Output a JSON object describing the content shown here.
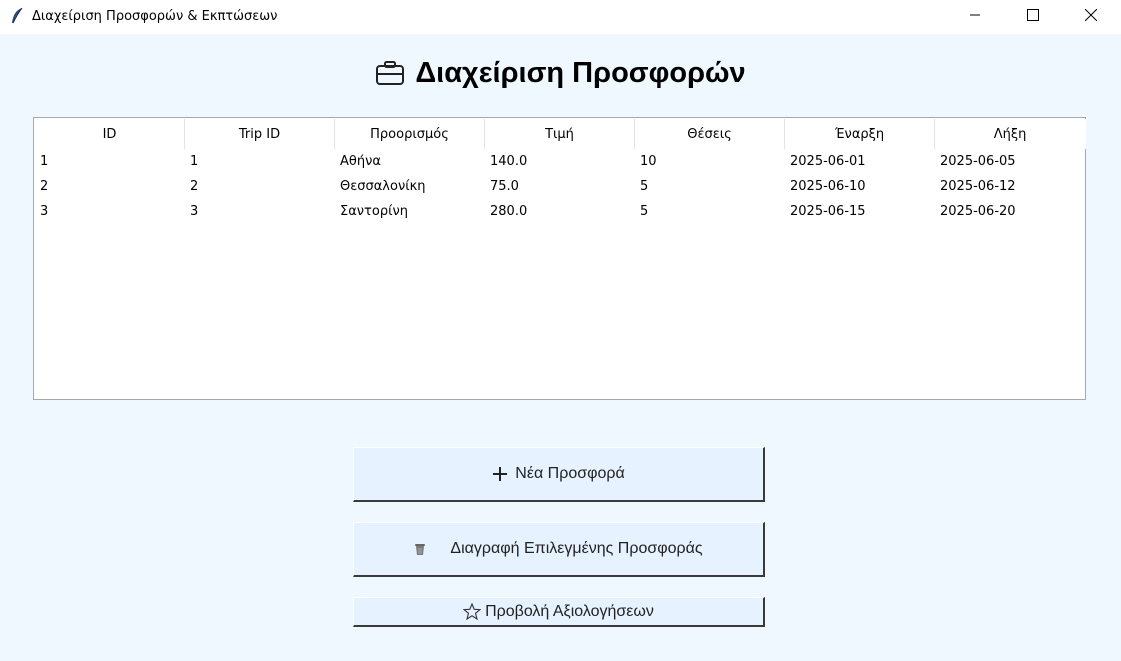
{
  "window": {
    "title": "Διαχείριση Προσφορών & Εκπτώσεων",
    "app_icon": "feather-icon",
    "controls": [
      "minimize-icon",
      "maximize-icon",
      "close-icon"
    ]
  },
  "page": {
    "title": "Διαχείριση Προσφορών",
    "title_icon": "briefcase-icon"
  },
  "table": {
    "columns": [
      "ID",
      "Trip ID",
      "Προορισμός",
      "Τιμή",
      "Θέσεις",
      "Έναρξη",
      "Λήξη"
    ],
    "rows": [
      [
        "1",
        "1",
        "Αθήνα",
        "140.0",
        "10",
        "2025-06-01",
        "2025-06-05"
      ],
      [
        "2",
        "2",
        "Θεσσαλονίκη",
        "75.0",
        "5",
        "2025-06-10",
        "2025-06-12"
      ],
      [
        "3",
        "3",
        "Σαντορίνη",
        "280.0",
        "5",
        "2025-06-15",
        "2025-06-20"
      ]
    ]
  },
  "actions": {
    "new_offer": {
      "label": "Νέα Προσφορά",
      "icon": "plus-icon"
    },
    "delete_selected": {
      "label": "Διαγραφή Επιλεγμένης Προσφοράς",
      "icon": "trash-icon"
    },
    "view_reviews": {
      "label": "Προβολή Αξιολογήσεων",
      "icon": "star-icon"
    }
  },
  "colors": {
    "background": "#f0f8ff",
    "button_background": "#e6f2ff",
    "table_background": "#ffffff"
  }
}
